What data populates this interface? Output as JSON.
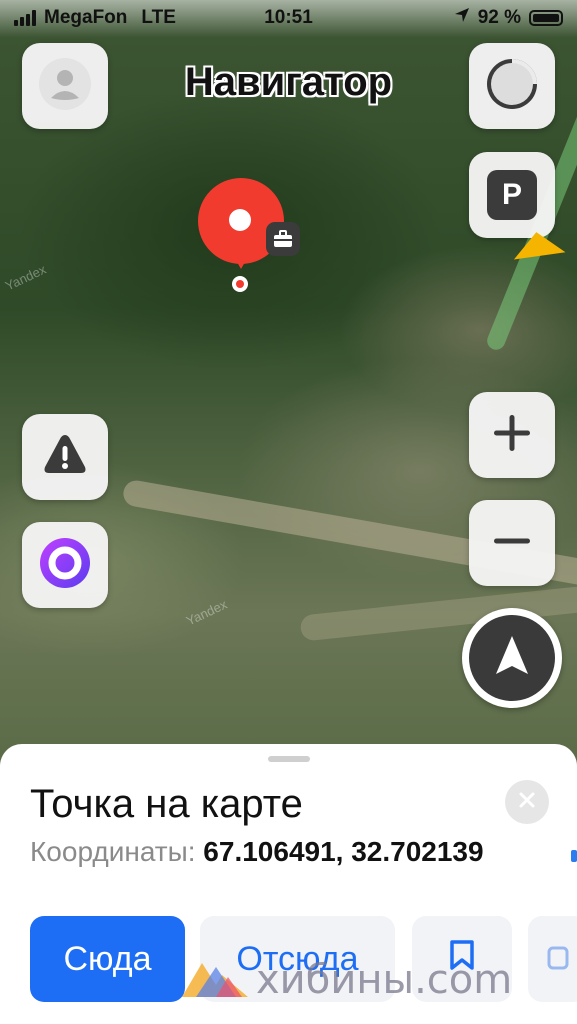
{
  "status_bar": {
    "carrier": "MegaFon",
    "network": "LTE",
    "time": "10:51",
    "battery_percent": "92 %",
    "battery_level": 0.92
  },
  "header": {
    "title": "Навигатор"
  },
  "map": {
    "watermark": "Yandex",
    "controls": {
      "profile_icon": "user-icon",
      "loading_icon": "progress-ring-icon",
      "parking_label": "P",
      "alert_icon": "warning-icon",
      "alice_icon": "alice-icon",
      "zoom_in_label": "+",
      "zoom_out_label": "−",
      "compass_icon": "navigation-arrow-icon"
    },
    "marker": {
      "type": "point",
      "icon": "briefcase-icon"
    }
  },
  "sheet": {
    "title": "Точка на карте",
    "coordinates_label": "Координаты:",
    "coordinates_value": "67.106491, 32.702139",
    "actions": {
      "here": "Сюда",
      "from": "Отсюда",
      "save_icon": "bookmark-icon"
    }
  },
  "overlay_watermark": "хибины.com",
  "colors": {
    "accent": "#1e6ef5",
    "pin": "#f23b2f",
    "alice": "#8a3ff0"
  }
}
